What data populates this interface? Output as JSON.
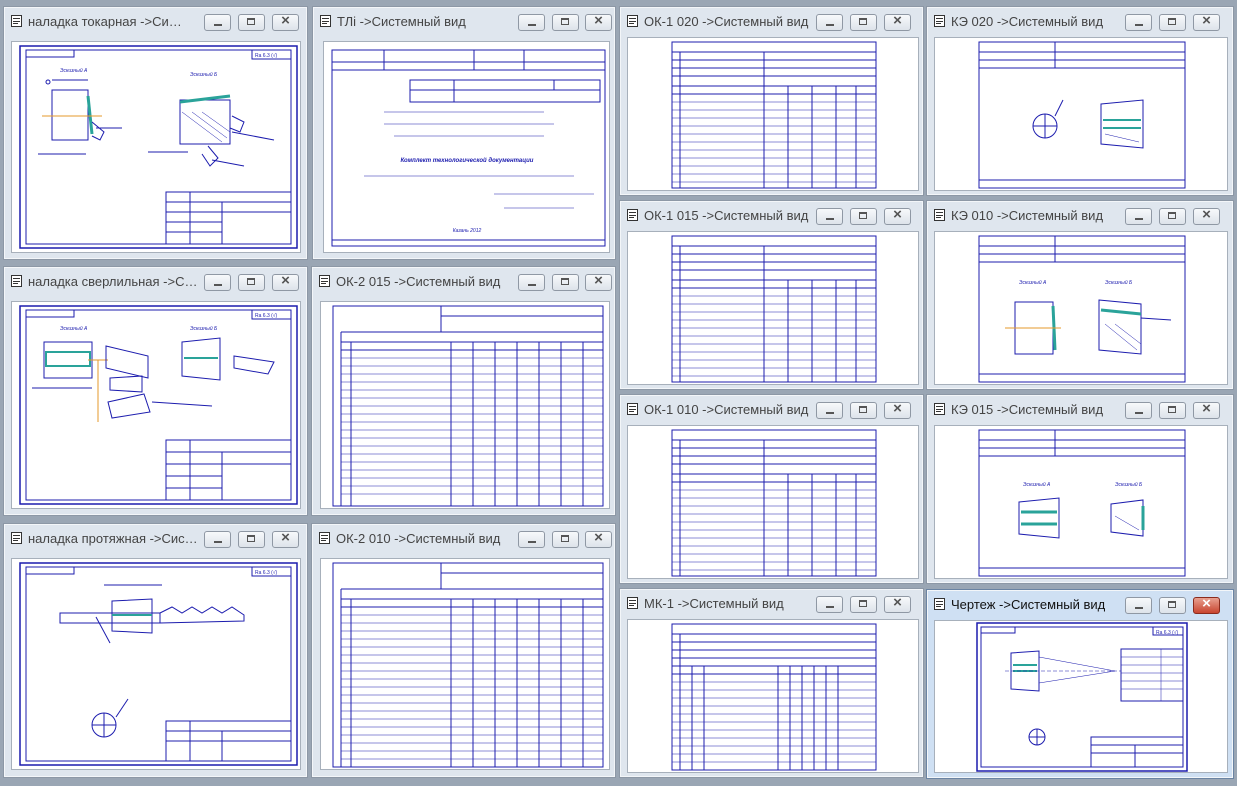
{
  "windows": [
    {
      "title": "наладка токарная ->Систем…"
    },
    {
      "title": "ТЛi ->Системный вид"
    },
    {
      "title": "ОК-1 020 ->Системный вид"
    },
    {
      "title": "КЭ 020 ->Системный вид"
    },
    {
      "title": "наладка сверлильная ->Сис…"
    },
    {
      "title": "ОК-2 015 ->Системный вид"
    },
    {
      "title": "ОК-1 015 ->Системный вид"
    },
    {
      "title": "КЭ 010 ->Системный вид"
    },
    {
      "title": "наладка протяжная ->Систе…"
    },
    {
      "title": "ОК-2 010 ->Системный вид"
    },
    {
      "title": "ОК-1 010 ->Системный вид"
    },
    {
      "title": "КЭ 015 ->Системный вид"
    },
    {
      "title": "МК-1 ->Системный вид"
    },
    {
      "title": "Чертеж ->Системный вид"
    }
  ],
  "sheet_text": {
    "titlepage_caption": "Комплект технологической документации",
    "titlepage_city": "Казань 2012",
    "sketch_a": "Эскизный А",
    "sketch_b": "Эскизный Б",
    "roughness": "Ra 6.3 (√)"
  },
  "colors": {
    "ink": "#1c1cae",
    "accent_teal": "#2aa39a"
  }
}
